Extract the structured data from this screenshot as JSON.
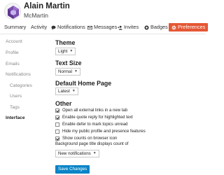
{
  "user": {
    "name": "Alain Martin",
    "handle": "McMartin"
  },
  "nav": {
    "summary": "Summary",
    "activity": "Activity",
    "notifications": "Notifications",
    "messages": "Messages",
    "invites": "Invites",
    "badges": "Badges",
    "preferences": "Preferences"
  },
  "sidebar": {
    "items": [
      "Account",
      "Profile",
      "Emails",
      "Notifications",
      "Categories",
      "Users",
      "Tags",
      "Interface"
    ]
  },
  "theme": {
    "title": "Theme",
    "value": "Light"
  },
  "text_size": {
    "title": "Text Size",
    "value": "Normal"
  },
  "home_page": {
    "title": "Default Home Page",
    "value": "Latest"
  },
  "other": {
    "title": "Other",
    "options": [
      {
        "label": "Open all external links in a new tab",
        "checked": true
      },
      {
        "label": "Enable quote reply for highlighted text",
        "checked": true
      },
      {
        "label": "Enable defer to mark topics unread",
        "checked": false
      },
      {
        "label": "Hide my public profile and presence features",
        "checked": false
      },
      {
        "label": "Show counts on browser icon",
        "checked": true
      }
    ],
    "title_count_label": "Background page title displays count of",
    "title_count_value": "New notifications"
  },
  "save_label": "Save Changes",
  "colors": {
    "accent": "#e45735",
    "button": "#0a84c6"
  }
}
